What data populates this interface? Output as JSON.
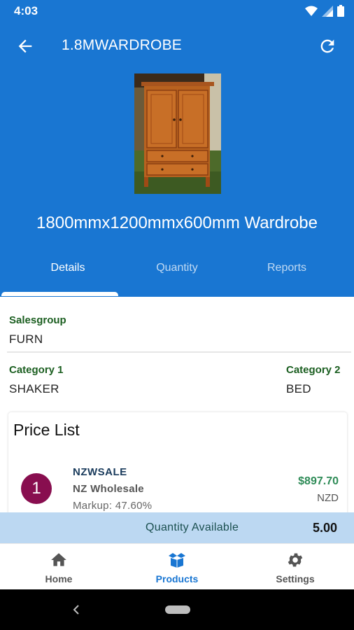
{
  "status_bar": {
    "time": "4:03",
    "icons": [
      "wifi-icon",
      "signal-icon",
      "battery-icon"
    ]
  },
  "app_bar": {
    "title": "1.8MWARDROBE",
    "back_icon": "arrow-back-icon",
    "refresh_icon": "refresh-icon"
  },
  "product": {
    "name": "1800mmx1200mmx600mm Wardrobe",
    "image": "wardrobe-photo"
  },
  "tabs": [
    {
      "label": "Details",
      "active": true
    },
    {
      "label": "Quantity",
      "active": false
    },
    {
      "label": "Reports",
      "active": false
    }
  ],
  "details": {
    "salesgroup_label": "Salesgroup",
    "salesgroup_value": "FURN",
    "category1_label": "Category 1",
    "category1_value": "SHAKER",
    "category2_label": "Category 2",
    "category2_value": "BED"
  },
  "price_list": {
    "title": "Price List",
    "items": [
      {
        "rank": "1",
        "code": "NZWSALE",
        "description": "NZ Wholesale",
        "markup": "Markup: 47.60%",
        "price": "$897.70",
        "currency": "NZD"
      }
    ]
  },
  "quantity_bar": {
    "label": "Quantity Available",
    "value": "5.00"
  },
  "bottom_nav": [
    {
      "label": "Home",
      "icon": "home-icon",
      "active": false
    },
    {
      "label": "Products",
      "icon": "box-icon",
      "active": true
    },
    {
      "label": "Settings",
      "icon": "gear-icon",
      "active": false
    }
  ],
  "colors": {
    "primary": "#1976d2",
    "label_green": "#1b5e20",
    "price_green": "#2e8b57",
    "badge": "#880e4f",
    "qty_bar": "#bcd8f2"
  }
}
